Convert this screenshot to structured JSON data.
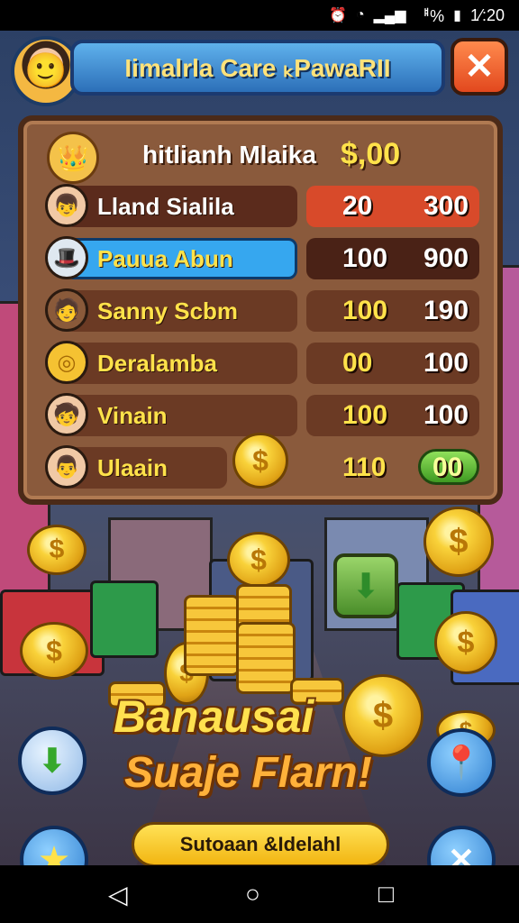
{
  "status_bar": {
    "signal_text": "ᅤ%",
    "time": "1⁄:20"
  },
  "header": {
    "title": "Iimalrla Care ₖPawaRII",
    "close_label": "✕"
  },
  "leaderboard": {
    "head": {
      "name": "hitlianh Mlaika",
      "amount": "$,00"
    },
    "rows": [
      {
        "name": "Lland Sialila",
        "v1": "20",
        "v2": "300",
        "name_color": "#5b2b1c",
        "val_color": "#d84a2a"
      },
      {
        "name": "Pauua Abun",
        "v1": "100",
        "v2": "900",
        "name_color": "#36a7ef",
        "val_color": "#4a2216"
      },
      {
        "name": "Sanny Scbm",
        "v1": "100",
        "v2": "190",
        "name_color": "#6b3a24",
        "val_color": "#5a2a18"
      },
      {
        "name": "Deralamba",
        "v1": "00",
        "v2": "100",
        "name_color": "#6b3a24",
        "val_color": "#5a2a18"
      },
      {
        "name": "Vinain",
        "v1": "100",
        "v2": "100",
        "name_color": "#6b3a24",
        "val_color": "#5a2a18"
      },
      {
        "name": "Ulaain",
        "v1": "110",
        "v2": "00",
        "name_color": "#6b3a24",
        "val_color": "#5a2a18"
      }
    ]
  },
  "promo": {
    "line1": "Banausai",
    "line2": "Suaje Flarn!",
    "cta_label": "Sutoaan &Idelahl"
  },
  "icons": {
    "coin_symbol": "$"
  }
}
